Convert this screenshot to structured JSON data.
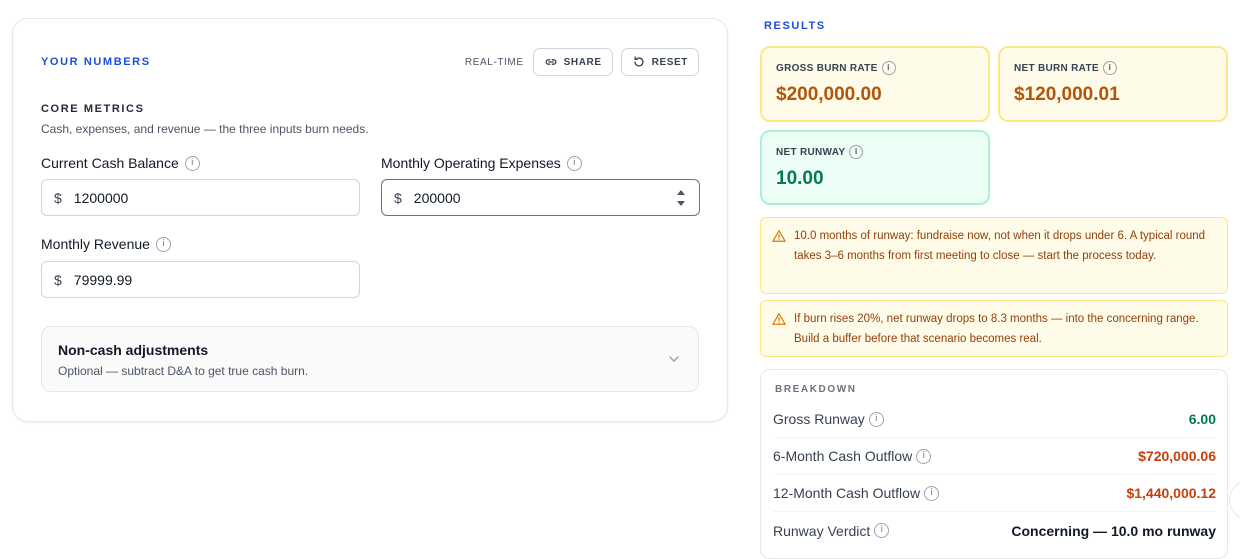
{
  "inputs_card": {
    "title": "YOUR NUMBERS",
    "realtime_label": "REAL-TIME",
    "share_label": "SHARE",
    "reset_label": "RESET",
    "section_title": "CORE METRICS",
    "section_subtitle": "Cash, expenses, and revenue — the three inputs burn needs.",
    "fields": [
      {
        "label": "Current Cash Balance",
        "currency": "$",
        "value": "1200000"
      },
      {
        "label": "Monthly Operating Expenses",
        "currency": "$",
        "value": "200000"
      },
      {
        "label": "Monthly Revenue",
        "currency": "$",
        "value": "79999.99"
      }
    ],
    "adjustments": {
      "title": "Non-cash adjustments",
      "subtitle": "Optional — subtract D&A to get true cash burn."
    },
    "info_glyph": "i"
  },
  "results": {
    "title": "RESULTS",
    "metrics": [
      {
        "label": "GROSS BURN RATE",
        "value": "$200,000.00",
        "color": "#b45309"
      },
      {
        "label": "NET BURN RATE",
        "value": "$120,000.01",
        "color": "#b45309"
      },
      {
        "label": "NET RUNWAY",
        "value": "10.00",
        "color": "#047857"
      }
    ],
    "alerts": [
      "10.0 months of runway: fundraise now, not when it drops under 6. A typical round takes 3–6 months from first meeting to close — start the process today.",
      "If burn rises 20%, net runway drops to 8.3 months — into the concerning range. Build a buffer before that scenario becomes real."
    ],
    "breakdown": {
      "title": "BREAKDOWN",
      "rows": [
        {
          "label": "Gross Runway",
          "value": "6.00"
        },
        {
          "label": "6-Month Cash Outflow",
          "value": "$720,000.06"
        },
        {
          "label": "12-Month Cash Outflow",
          "value": "$1,440,000.12"
        },
        {
          "label": "Runway Verdict",
          "value": "Concerning — 10.0 mo runway"
        }
      ]
    }
  },
  "colors": {
    "accent": "#1d4ed8",
    "warning_bg": "#fefce8",
    "warning_border": "#fde68a",
    "success_bg": "#ecfdf5",
    "success_border": "#a7f3d0"
  },
  "icons": [
    "link-icon",
    "reset-icon",
    "info-icon",
    "stepper-icon",
    "chevron-down-icon",
    "warning-icon"
  ]
}
